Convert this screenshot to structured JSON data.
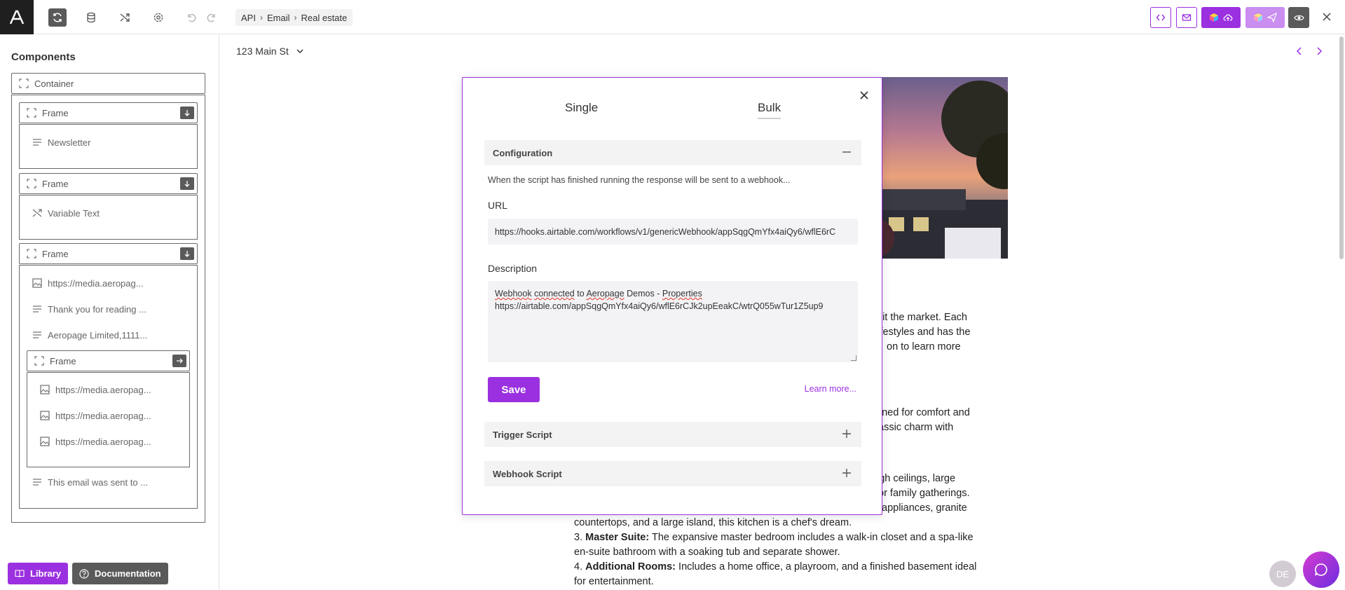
{
  "topbar": {
    "logo_icon": "aeropage-logo-icon",
    "breadcrumb": [
      "API",
      "Email",
      "Real estate"
    ],
    "icons": [
      "sync-icon",
      "database-icon",
      "shuffle-icon",
      "settings-icon",
      "undo-icon",
      "redo-icon"
    ],
    "right_icons": [
      "code-icon",
      "mail-icon",
      "cloud-upload-icon",
      "send-icon",
      "eye-icon",
      "close-icon"
    ]
  },
  "sidebar": {
    "title": "Components",
    "container_label": "Container",
    "frame1": {
      "label": "Frame",
      "child": "Newsletter"
    },
    "frame2": {
      "label": "Frame",
      "child": "Variable Text"
    },
    "frame3": {
      "label": "Frame",
      "children": [
        "https://media.aeropag...",
        "Thank you for reading ...",
        "Aeropage Limited,1111..."
      ],
      "nested_frame": {
        "label": "Frame",
        "children": [
          "https://media.aeropag...",
          "https://media.aeropag...",
          "https://media.aeropag..."
        ]
      },
      "last_child": "This email was sent to ..."
    },
    "library_label": "Library",
    "documentation_label": "Documentation"
  },
  "canvas": {
    "address": "123 Main St",
    "email_lines": {
      "l1": "hit the market. Each",
      "l2": "lifestyles and has the",
      "l3": "on to learn more",
      "l4": "gned for comfort and",
      "l5": "assic charm with",
      "l6": "igh ceilings, large",
      "l7": "or family gatherings.",
      "l8": "appliances, granite",
      "l9": "countertops, and a large island, this kitchen is a chef's dream.",
      "item3_prefix": "3.",
      "item3_title": "Master Suite:",
      "item3_text": "The expansive master bedroom includes a walk-in closet and a spa-like",
      "item3_text2": "en-suite bathroom with a soaking tub and separate shower.",
      "item4_prefix": "4.",
      "item4_title": "Additional Rooms:",
      "item4_text": "Includes a home office, a playroom, and a finished basement ideal",
      "item4_text2": "for entertainment."
    }
  },
  "modal": {
    "tab_single": "Single",
    "tab_bulk": "Bulk",
    "configuration_label": "Configuration",
    "helper_text": "When the script has finished running the response will be sent to a webhook...",
    "url_label": "URL",
    "url_value": "https://hooks.airtable.com/workflows/v1/genericWebhook/appSqgQmYfx4aiQy6/wflE6rC",
    "description_label": "Description",
    "description_line1_a": "Webhook",
    "description_line1_b": "connected",
    "description_line1_c": " to ",
    "description_line1_d": "Aeropage",
    "description_line1_e": " Demos - ",
    "description_line1_f": "Properties",
    "description_line2": "https://airtable.com/appSqgQmYfx4aiQy6/wflE6rCJk2upEeakC/wtrQ055wTur1Z5up9",
    "save_label": "Save",
    "learn_more": "Learn more...",
    "trigger_label": "Trigger Script",
    "webhook_label": "Webhook Script"
  },
  "floating": {
    "avatar_initials": "DE",
    "chat_icon": "chat-icon"
  },
  "colors": {
    "accent": "#9b30e0",
    "dark": "#1f1f1f"
  }
}
